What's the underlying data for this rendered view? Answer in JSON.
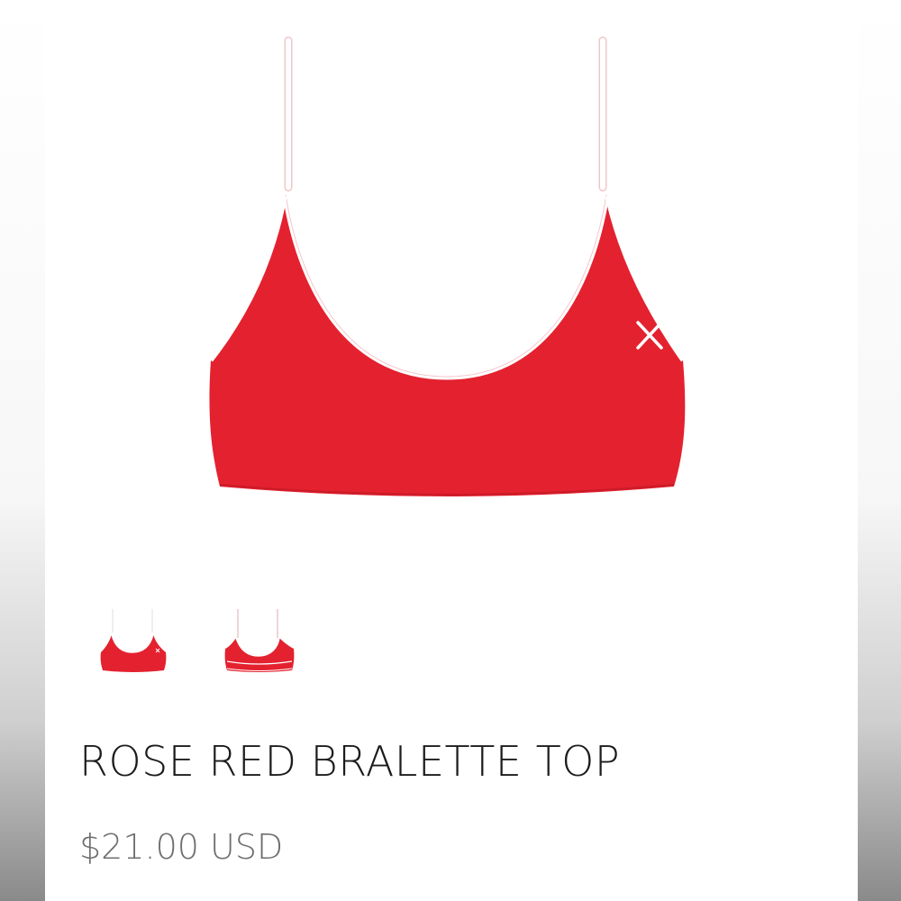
{
  "product": {
    "title": "ROSE RED BRALETTE TOP",
    "price": "$21.00 USD",
    "color_hex": "#e4212f",
    "trim_hex": "#ffffff"
  },
  "images": {
    "main": {
      "view": "front",
      "icon": "x-logo"
    },
    "thumbnails": [
      {
        "view": "front",
        "selected": true
      },
      {
        "view": "back",
        "selected": false
      }
    ]
  }
}
